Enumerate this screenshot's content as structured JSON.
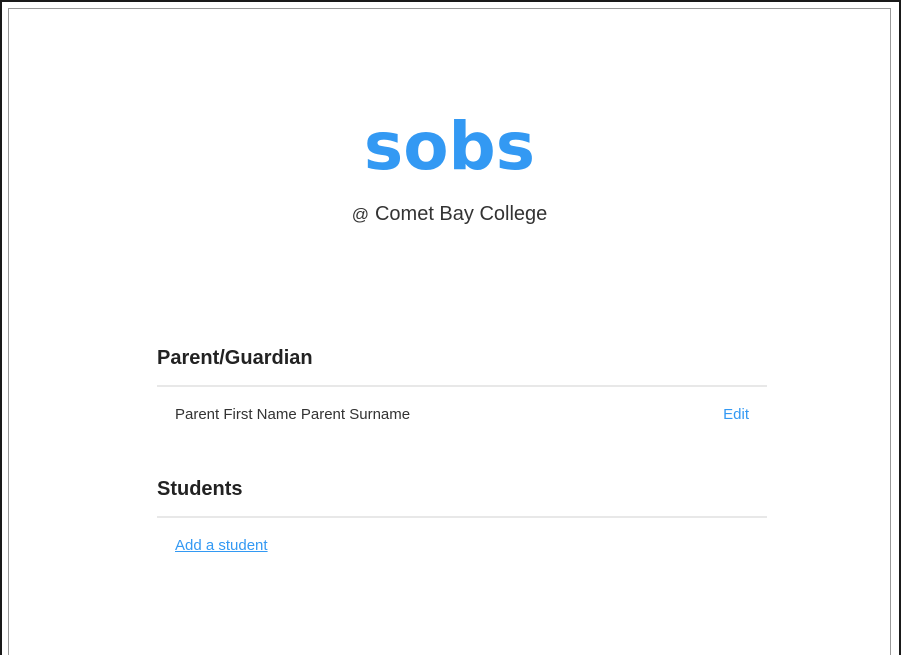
{
  "brand": {
    "logo_text": "sobs",
    "at_symbol": "@",
    "school_name": "Comet Bay College",
    "brand_color": "#3399f3"
  },
  "parent_section": {
    "title": "Parent/Guardian",
    "parent_name": "Parent First Name Parent Surname",
    "edit_label": "Edit"
  },
  "students_section": {
    "title": "Students",
    "add_label": "Add a student"
  }
}
